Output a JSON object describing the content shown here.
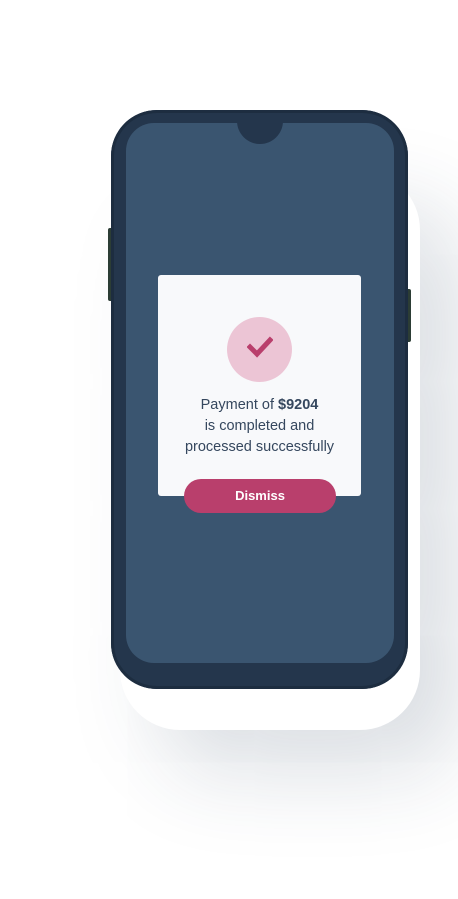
{
  "dialog": {
    "message_prefix": "Payment of ",
    "amount": "$9204",
    "message_line2": "is completed and",
    "message_line3": "processed successfully",
    "dismiss_label": "Dismiss"
  },
  "icons": {
    "status": "checkmark-icon"
  },
  "colors": {
    "screen_background": "#3a5570",
    "phone_frame": "#24364c",
    "card_background": "#f8f9fb",
    "accent": "#b93f6c",
    "icon_circle": "#ecc5d5",
    "text": "#35475e"
  }
}
